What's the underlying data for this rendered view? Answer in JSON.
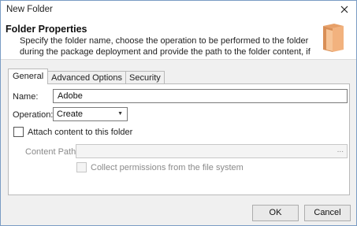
{
  "window": {
    "title": "New Folder"
  },
  "header": {
    "title": "Folder Properties",
    "description": "Specify the folder name, choose the operation to be performed to the folder during the package deployment and provide the path to the folder content, if required."
  },
  "tabs": [
    {
      "label": "General"
    },
    {
      "label": "Advanced Options"
    },
    {
      "label": "Security"
    }
  ],
  "form": {
    "name_label": "Name:",
    "name_value": "Adobe",
    "operation_label": "Operation:",
    "operation_value": "Create",
    "attach_label": "Attach content to this folder",
    "content_path_label": "Content Path:",
    "content_path_value": "",
    "browse_label": "...",
    "collect_label": "Collect permissions from the file system"
  },
  "footer": {
    "ok_label": "OK",
    "cancel_label": "Cancel"
  },
  "colors": {
    "folder": "#f2b27e",
    "folder_dark": "#d98f56",
    "window_border": "#7a9cc4"
  }
}
